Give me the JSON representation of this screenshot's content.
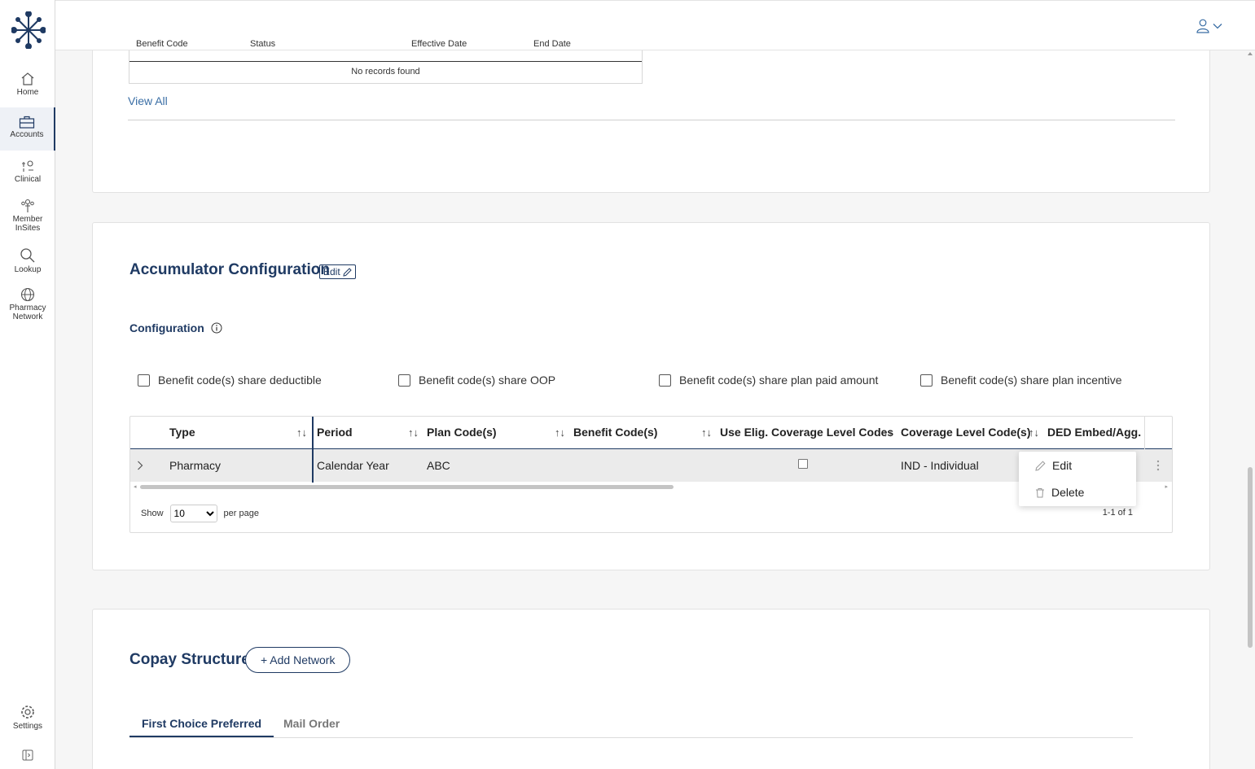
{
  "sidebar": {
    "items": [
      {
        "label": "Home",
        "icon": "home-icon"
      },
      {
        "label": "Accounts",
        "icon": "briefcase-icon"
      },
      {
        "label": "Clinical",
        "icon": "clinical-icon"
      },
      {
        "label": "Member InSites",
        "icon": "people-icon"
      },
      {
        "label": "Lookup",
        "icon": "search-icon"
      },
      {
        "label": "Pharmacy Network",
        "icon": "globe-icon"
      }
    ],
    "settings": "Settings"
  },
  "benefit_table": {
    "headers": [
      "Benefit Code",
      "Status",
      "Effective Date",
      "End Date"
    ],
    "empty_text": "No records found",
    "view_all": "View All"
  },
  "accumulator": {
    "title": "Accumulator Configuration",
    "edit_label": "Edit",
    "config_title": "Configuration",
    "checkboxes": [
      "Benefit code(s) share deductible",
      "Benefit code(s) share OOP",
      "Benefit code(s) share plan paid amount",
      "Benefit code(s) share plan incentive"
    ],
    "columns": [
      "Type",
      "Period",
      "Plan Code(s)",
      "Benefit Code(s)",
      "Use Elig. Coverage Level Codes",
      "Coverage Level Code(s)",
      "DED Embed/Agg."
    ],
    "row": {
      "type": "Pharmacy",
      "period": "Calendar Year",
      "plan_code": "ABC",
      "benefit_code": "",
      "coverage_level": "IND - Individual"
    },
    "show_label": "Show",
    "per_page_value": "10",
    "per_page_label": "per page",
    "page_info": "1-1 of 1",
    "context_menu": {
      "edit": "Edit",
      "delete": "Delete"
    }
  },
  "copay": {
    "title": "Copay Structure",
    "add_network": "+ Add Network",
    "tabs": [
      "First Choice Preferred",
      "Mail Order"
    ]
  },
  "colors": {
    "primary": "#1f3a63",
    "link": "#3a6ea5"
  }
}
